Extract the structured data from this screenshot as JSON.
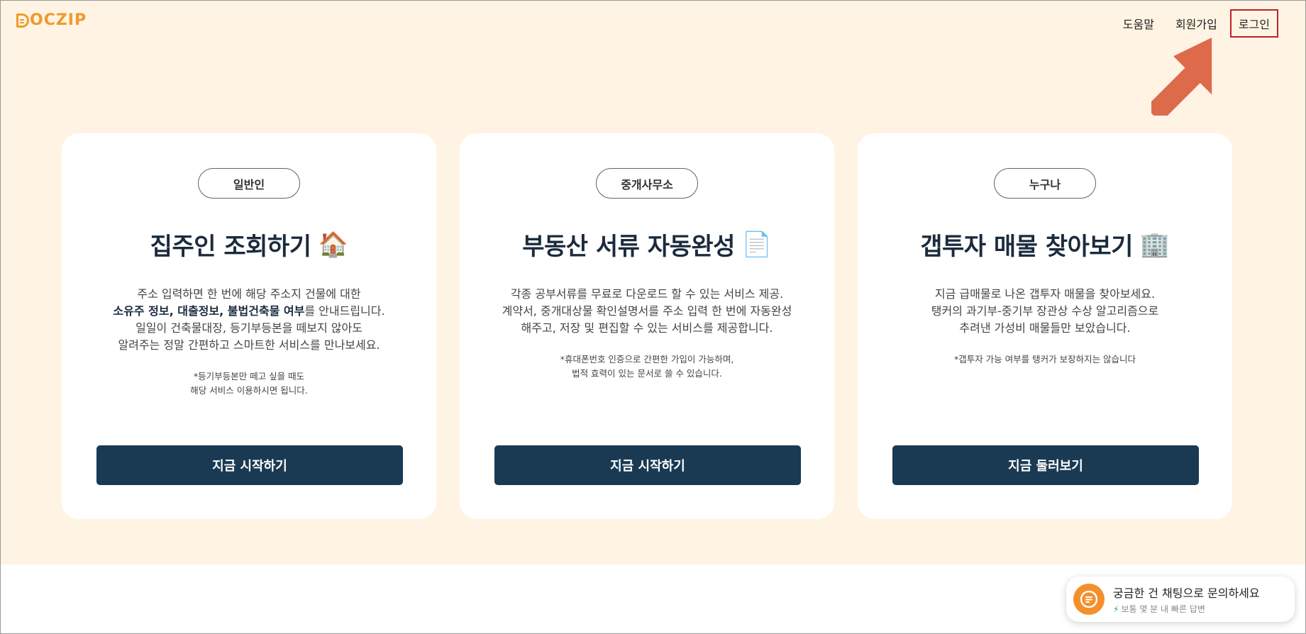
{
  "brand": {
    "logo_text": "OCZIP",
    "logo_letter": "D"
  },
  "nav": {
    "help": "도움말",
    "signup": "회원가입",
    "login": "로그인"
  },
  "cards": [
    {
      "tag": "일반인",
      "title": "집주인 조회하기",
      "emoji": "🏠",
      "desc_line1": "주소 입력하면 한 번에 해당 주소지 건물에 대한",
      "desc_bold": "소유주 정보, 대출정보, 불법건축물 여부",
      "desc_line2_rest": "를 안내드립니다.",
      "desc_line3": "일일이 건축물대장, 등기부등본을 떼보지 않아도",
      "desc_line4": "알려주는 정말 간편하고 스마트한 서비스를 만나보세요.",
      "note_line1": "*등기부등본만 떼고 싶을 때도",
      "note_line2": "해당 서비스 이용하시면 됩니다.",
      "cta": "지금 시작하기"
    },
    {
      "tag": "중개사무소",
      "title": "부동산 서류 자동완성",
      "emoji": "📄",
      "desc_line1": "각종 공부서류를 무료로 다운로드 할 수 있는 서비스 제공.",
      "desc_line2": "계약서, 중개대상물 확인설명서를 주소 입력 한 번에 자동완성",
      "desc_line3": "해주고, 저장 및 편집할 수 있는 서비스를 제공합니다.",
      "note_line1": "*휴대폰번호 인증으로 간편한 가입이 가능하며,",
      "note_line2": "법적 효력이 있는 문서로 쓸 수 있습니다.",
      "cta": "지금 시작하기"
    },
    {
      "tag": "누구나",
      "title": "갭투자 매물 찾아보기",
      "emoji": "🏢",
      "desc_line1": "지금 급매물로 나온 갭투자 매물을 찾아보세요.",
      "desc_line2": "탱커의 과기부-중기부 장관상 수상 알고리즘으로",
      "desc_line3": "추려낸 가성비 매물들만 보았습니다.",
      "note_line1": "*갭투자 가능 여부를 탱커가 보장하지는 않습니다",
      "cta": "지금 둘러보기"
    }
  ],
  "chat": {
    "title": "궁금한 건 채팅으로 문의하세요",
    "subtitle": "보통 몇 분 내 빠른 답변"
  },
  "colors": {
    "hero_bg": "#fff4e3",
    "brand_orange": "#f09a2a",
    "navy": "#1a3a53",
    "arrow": "#de6a4c",
    "highlight_border": "#c0202a"
  }
}
